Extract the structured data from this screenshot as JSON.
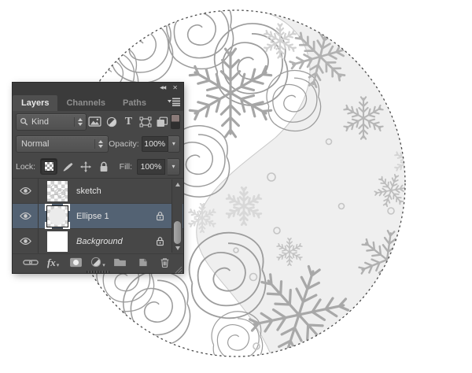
{
  "panel": {
    "title_bar": {
      "collapse_icon": "◀◀",
      "close_icon": "✕"
    },
    "tabs": [
      {
        "label": "Layers",
        "active": true
      },
      {
        "label": "Channels",
        "active": false
      },
      {
        "label": "Paths",
        "active": false
      }
    ],
    "filter_row": {
      "kind_label": "Kind",
      "icon_names": [
        "pixel-layer-filter",
        "adjustment-layer-filter",
        "type-layer-filter",
        "shape-layer-filter",
        "smart-object-filter",
        "filtering-toggle"
      ],
      "type_glyph": "T"
    },
    "blend_row": {
      "blend_mode": "Normal",
      "opacity_label": "Opacity:",
      "opacity_value": "100%",
      "caret": "▾"
    },
    "lock_row": {
      "lock_label": "Lock:",
      "fill_label": "Fill:",
      "fill_value": "100%",
      "caret": "▾",
      "buttons": [
        "lock-transparent-pixels (pressed)",
        "lock-image-pixels",
        "lock-position",
        "lock-all"
      ]
    },
    "layers": [
      {
        "name": "sketch",
        "visible": true,
        "selected": false,
        "locked": false,
        "thumbnail": "transparent-checker-with-sketch"
      },
      {
        "name": "Ellipse 1",
        "visible": true,
        "selected": true,
        "locked": true,
        "thumbnail": "transparent-checker-with-light-ellipse"
      },
      {
        "name": "Background",
        "visible": true,
        "selected": false,
        "locked": true,
        "thumbnail": "solid-white",
        "italic": true
      }
    ],
    "footer": {
      "fx_label": "fx",
      "caret": "▾",
      "icon_names": [
        "link-layers",
        "layer-style-fx",
        "add-layer-mask",
        "new-adjustment-layer",
        "new-group",
        "new-layer",
        "delete-layer"
      ]
    },
    "colors": {
      "panel_bg": "#474747",
      "header_bg": "#3b3b3b",
      "active_tab_bg": "#4f4f4f",
      "selected_row": "#536273",
      "text": "#d6d6d6",
      "value_box_bg": "#3a3a3a"
    }
  },
  "canvas": {
    "description": "white canvas with elliptical marching-ants selection containing a pencil sketch of roses (left) and snowflakes on light gray (right), split by an S-curve",
    "selection_style": "dashed-ellipse",
    "colors": {
      "background": "#ffffff",
      "snow_region": "#efefef",
      "rose_line": "#9c9c9c",
      "flake_line": "#b2b2b2",
      "ants": "#4a4a4a"
    }
  }
}
